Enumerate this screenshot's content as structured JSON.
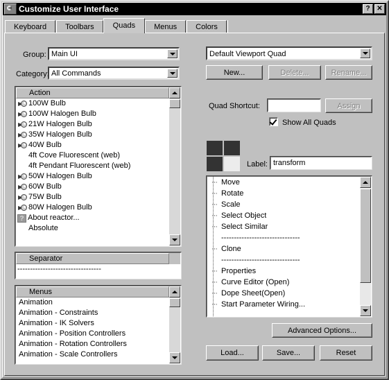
{
  "window": {
    "title": "Customize User Interface",
    "app_icon": "app-spiral-icon",
    "help_button": "?",
    "close_button": "✕"
  },
  "tabs": [
    {
      "label": "Keyboard",
      "active": false
    },
    {
      "label": "Toolbars",
      "active": false
    },
    {
      "label": "Quads",
      "active": true
    },
    {
      "label": "Menus",
      "active": false
    },
    {
      "label": "Colors",
      "active": false
    }
  ],
  "left": {
    "group_label": "Group:",
    "group_value": "Main UI",
    "category_label": "Category:",
    "category_value": "All Commands",
    "action_header": "Action",
    "actions": [
      {
        "label": "100W Bulb",
        "icon": "bulb-icon"
      },
      {
        "label": "100W Halogen Bulb",
        "icon": "bulb-icon"
      },
      {
        "label": "21W Halogen Bulb",
        "icon": "bulb-icon"
      },
      {
        "label": "35W Halogen Bulb",
        "icon": "bulb-icon"
      },
      {
        "label": "40W Bulb",
        "icon": "bulb-icon"
      },
      {
        "label": "4ft Cove Fluorescent (web)",
        "icon": "none"
      },
      {
        "label": "4ft Pendant Fluorescent (web)",
        "icon": "none"
      },
      {
        "label": "50W Halogen Bulb",
        "icon": "bulb-icon"
      },
      {
        "label": "60W Bulb",
        "icon": "bulb-icon"
      },
      {
        "label": "75W Bulb",
        "icon": "bulb-icon"
      },
      {
        "label": "80W Halogen Bulb",
        "icon": "bulb-icon"
      },
      {
        "label": "About reactor...",
        "icon": "question-icon"
      },
      {
        "label": "Absolute",
        "icon": "none"
      }
    ],
    "separator_header": "Separator",
    "separator_item": "---------------------------------",
    "menus_header": "Menus",
    "menus": [
      {
        "label": "Animation"
      },
      {
        "label": "Animation - Constraints"
      },
      {
        "label": "Animation - IK Solvers"
      },
      {
        "label": "Animation - Position Controllers"
      },
      {
        "label": "Animation - Rotation Controllers"
      },
      {
        "label": "Animation - Scale Controllers"
      }
    ]
  },
  "right": {
    "quad_set_value": "Default Viewport Quad",
    "new_button": "New...",
    "delete_button": "Delete...",
    "rename_button": "Rename...",
    "shortcut_label": "Quad Shortcut:",
    "shortcut_value": "",
    "assign_button": "Assign",
    "show_all_quads_label": "Show All Quads",
    "show_all_quads_checked": true,
    "quad_cells": [
      {
        "name": "upper-left",
        "selected": false
      },
      {
        "name": "upper-right",
        "selected": false
      },
      {
        "name": "lower-left",
        "selected": false
      },
      {
        "name": "lower-right",
        "selected": true
      }
    ],
    "label_label": "Label:",
    "label_value": "transform",
    "commands": [
      {
        "label": "Move",
        "type": "item"
      },
      {
        "label": "Rotate",
        "type": "item"
      },
      {
        "label": "Scale",
        "type": "item"
      },
      {
        "label": "Select Object",
        "type": "item"
      },
      {
        "label": "Select Similar",
        "type": "item"
      },
      {
        "label": "-------------------------------",
        "type": "separator"
      },
      {
        "label": "Clone",
        "type": "item"
      },
      {
        "label": "-------------------------------",
        "type": "separator"
      },
      {
        "label": "Properties",
        "type": "item"
      },
      {
        "label": "Curve Editor (Open)",
        "type": "item"
      },
      {
        "label": "Dope Sheet(Open)",
        "type": "item"
      },
      {
        "label": "Start Parameter Wiring...",
        "type": "item"
      }
    ],
    "advanced_button": "Advanced Options...",
    "load_button": "Load...",
    "save_button": "Save...",
    "reset_button": "Reset"
  },
  "colors": {
    "face": "#c0c0c0",
    "panel": "#c8c8c8",
    "titlebar": "#000000",
    "field": "#ffffff",
    "quad_dark": "#333333",
    "quad_light": "#ececec",
    "disabled_text": "#808080"
  }
}
